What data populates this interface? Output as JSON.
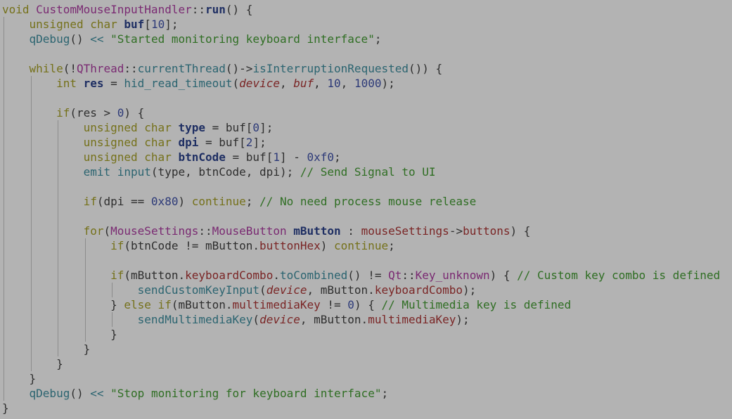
{
  "editor": {
    "background": "#b3b3b3",
    "language": "C++",
    "lines": [
      {
        "indent": 0,
        "tokens": [
          [
            "kw",
            "void "
          ],
          [
            "ty",
            "CustomMouseInputHandler"
          ],
          [
            "pl",
            "::"
          ],
          [
            "b",
            "run"
          ],
          [
            "pl",
            "() {"
          ]
        ]
      },
      {
        "indent": 1,
        "tokens": [
          [
            "kw",
            "unsigned char "
          ],
          [
            "b",
            "buf"
          ],
          [
            "pl",
            "["
          ],
          [
            "num",
            "10"
          ],
          [
            "pl",
            "];"
          ]
        ]
      },
      {
        "indent": 1,
        "tokens": [
          [
            "fn",
            "qDebug"
          ],
          [
            "pl",
            "() "
          ],
          [
            "fn",
            "<<"
          ],
          [
            "pl",
            " "
          ],
          [
            "str",
            "\"Started monitoring keyboard interface\""
          ],
          [
            "pl",
            ";"
          ]
        ]
      },
      {
        "indent": 0,
        "tokens": []
      },
      {
        "indent": 1,
        "tokens": [
          [
            "kw",
            "while"
          ],
          [
            "pl",
            "(!"
          ],
          [
            "ty",
            "QThread"
          ],
          [
            "pl",
            "::"
          ],
          [
            "fn",
            "currentThread"
          ],
          [
            "pl",
            "()->"
          ],
          [
            "fn",
            "isInterruptionRequested"
          ],
          [
            "pl",
            "()) {"
          ]
        ]
      },
      {
        "indent": 2,
        "tokens": [
          [
            "kw",
            "int "
          ],
          [
            "b",
            "res"
          ],
          [
            "pl",
            " = "
          ],
          [
            "fn",
            "hid_read_timeout"
          ],
          [
            "pl",
            "("
          ],
          [
            "it",
            "device"
          ],
          [
            "pl",
            ", "
          ],
          [
            "it",
            "buf"
          ],
          [
            "pl",
            ", "
          ],
          [
            "num",
            "10"
          ],
          [
            "pl",
            ", "
          ],
          [
            "num",
            "1000"
          ],
          [
            "pl",
            ");"
          ]
        ]
      },
      {
        "indent": 0,
        "tokens": []
      },
      {
        "indent": 2,
        "tokens": [
          [
            "kw",
            "if"
          ],
          [
            "pl",
            "(res > "
          ],
          [
            "num",
            "0"
          ],
          [
            "pl",
            ") {"
          ]
        ]
      },
      {
        "indent": 3,
        "tokens": [
          [
            "kw",
            "unsigned char "
          ],
          [
            "b",
            "type"
          ],
          [
            "pl",
            " = buf["
          ],
          [
            "num",
            "0"
          ],
          [
            "pl",
            "];"
          ]
        ]
      },
      {
        "indent": 3,
        "tokens": [
          [
            "kw",
            "unsigned char "
          ],
          [
            "b",
            "dpi"
          ],
          [
            "pl",
            " = buf["
          ],
          [
            "num",
            "2"
          ],
          [
            "pl",
            "];"
          ]
        ]
      },
      {
        "indent": 3,
        "tokens": [
          [
            "kw",
            "unsigned char "
          ],
          [
            "b",
            "btnCode"
          ],
          [
            "pl",
            " = buf["
          ],
          [
            "num",
            "1"
          ],
          [
            "pl",
            "] - "
          ],
          [
            "num",
            "0xf0"
          ],
          [
            "pl",
            ";"
          ]
        ]
      },
      {
        "indent": 3,
        "tokens": [
          [
            "fn",
            "emit input"
          ],
          [
            "pl",
            "(type, btnCode, dpi); "
          ],
          [
            "cm",
            "// Send Signal to UI"
          ]
        ]
      },
      {
        "indent": 0,
        "tokens": []
      },
      {
        "indent": 3,
        "tokens": [
          [
            "kw",
            "if"
          ],
          [
            "pl",
            "(dpi == "
          ],
          [
            "num",
            "0x80"
          ],
          [
            "pl",
            ") "
          ],
          [
            "kw",
            "continue"
          ],
          [
            "pl",
            "; "
          ],
          [
            "cm",
            "// No need process mouse release"
          ]
        ]
      },
      {
        "indent": 0,
        "tokens": []
      },
      {
        "indent": 3,
        "tokens": [
          [
            "kw",
            "for"
          ],
          [
            "pl",
            "("
          ],
          [
            "ty",
            "MouseSettings"
          ],
          [
            "pl",
            "::"
          ],
          [
            "ty",
            "MouseButton "
          ],
          [
            "b",
            "mButton"
          ],
          [
            "pl",
            " : "
          ],
          [
            "mem",
            "mouseSettings"
          ],
          [
            "pl",
            "->"
          ],
          [
            "mem",
            "buttons"
          ],
          [
            "pl",
            ") {"
          ]
        ]
      },
      {
        "indent": 4,
        "tokens": [
          [
            "kw",
            "if"
          ],
          [
            "pl",
            "(btnCode != mButton."
          ],
          [
            "mem",
            "buttonHex"
          ],
          [
            "pl",
            ") "
          ],
          [
            "kw",
            "continue"
          ],
          [
            "pl",
            ";"
          ]
        ]
      },
      {
        "indent": 0,
        "tokens": []
      },
      {
        "indent": 4,
        "tokens": [
          [
            "kw",
            "if"
          ],
          [
            "pl",
            "(mButton."
          ],
          [
            "mem",
            "keyboardCombo"
          ],
          [
            "pl",
            "."
          ],
          [
            "fn",
            "toCombined"
          ],
          [
            "pl",
            "() != "
          ],
          [
            "ty",
            "Qt"
          ],
          [
            "pl",
            "::"
          ],
          [
            "ty",
            "Key_unknown"
          ],
          [
            "pl",
            ") { "
          ],
          [
            "cm",
            "// Custom key combo is defined"
          ]
        ]
      },
      {
        "indent": 5,
        "tokens": [
          [
            "fn",
            "sendCustomKeyInput"
          ],
          [
            "pl",
            "("
          ],
          [
            "it",
            "device"
          ],
          [
            "pl",
            ", mButton."
          ],
          [
            "mem",
            "keyboardCombo"
          ],
          [
            "pl",
            ");"
          ]
        ]
      },
      {
        "indent": 4,
        "tokens": [
          [
            "pl",
            "} "
          ],
          [
            "kw",
            "else if"
          ],
          [
            "pl",
            "(mButton."
          ],
          [
            "mem",
            "multimediaKey"
          ],
          [
            "pl",
            " != "
          ],
          [
            "num",
            "0"
          ],
          [
            "pl",
            ") { "
          ],
          [
            "cm",
            "// Multimedia key is defined"
          ]
        ]
      },
      {
        "indent": 5,
        "tokens": [
          [
            "fn",
            "sendMultimediaKey"
          ],
          [
            "pl",
            "("
          ],
          [
            "it",
            "device"
          ],
          [
            "pl",
            ", mButton."
          ],
          [
            "mem",
            "multimediaKey"
          ],
          [
            "pl",
            ");"
          ]
        ]
      },
      {
        "indent": 4,
        "tokens": [
          [
            "pl",
            "}"
          ]
        ]
      },
      {
        "indent": 3,
        "tokens": [
          [
            "pl",
            "}"
          ]
        ]
      },
      {
        "indent": 2,
        "tokens": [
          [
            "pl",
            "}"
          ]
        ]
      },
      {
        "indent": 1,
        "tokens": [
          [
            "pl",
            "}"
          ]
        ]
      },
      {
        "indent": 1,
        "tokens": [
          [
            "fn",
            "qDebug"
          ],
          [
            "pl",
            "() "
          ],
          [
            "fn",
            "<<"
          ],
          [
            "pl",
            " "
          ],
          [
            "str",
            "\"Stop monitoring for keyboard interface\""
          ],
          [
            "pl",
            ";"
          ]
        ]
      },
      {
        "indent": 0,
        "tokens": [
          [
            "pl",
            "}"
          ]
        ]
      }
    ],
    "guides": [
      [],
      [
        0
      ],
      [
        0
      ],
      [
        0
      ],
      [
        0
      ],
      [
        0,
        1
      ],
      [
        0,
        1
      ],
      [
        0,
        1
      ],
      [
        0,
        1,
        2
      ],
      [
        0,
        1,
        2
      ],
      [
        0,
        1,
        2
      ],
      [
        0,
        1,
        2
      ],
      [
        0,
        1,
        2
      ],
      [
        0,
        1,
        2
      ],
      [
        0,
        1,
        2
      ],
      [
        0,
        1,
        2
      ],
      [
        0,
        1,
        2,
        3
      ],
      [
        0,
        1,
        2,
        3
      ],
      [
        0,
        1,
        2,
        3
      ],
      [
        0,
        1,
        2,
        3,
        4
      ],
      [
        0,
        1,
        2,
        3
      ],
      [
        0,
        1,
        2,
        3,
        4
      ],
      [
        0,
        1,
        2,
        3
      ],
      [
        0,
        1,
        2
      ],
      [
        0,
        1
      ],
      [
        0
      ],
      [
        0
      ],
      []
    ]
  }
}
